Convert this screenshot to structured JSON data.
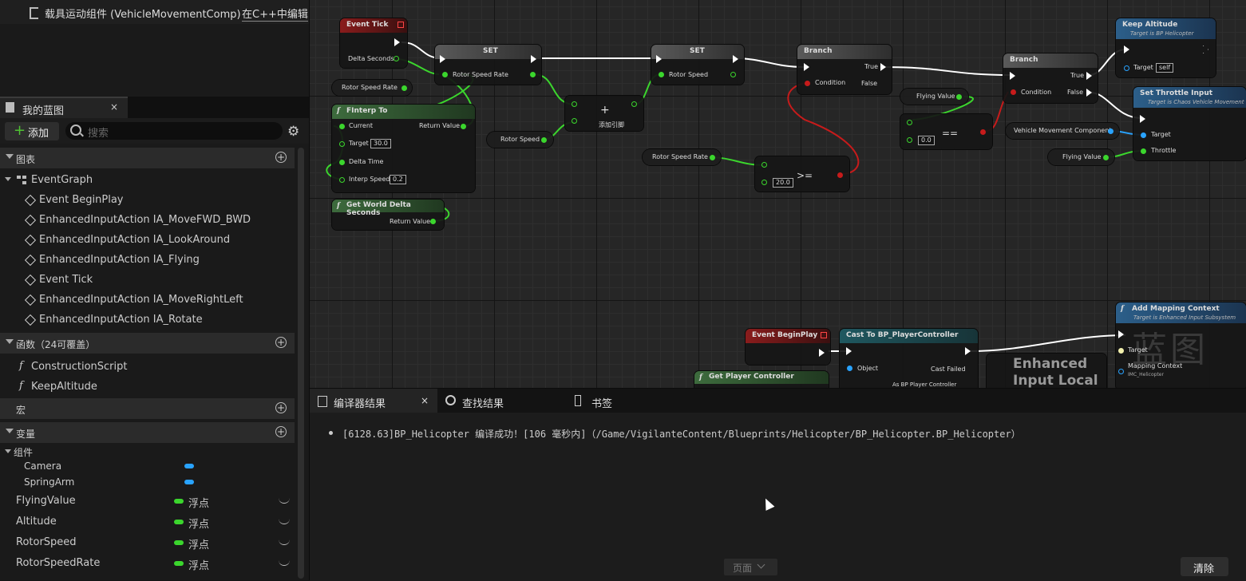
{
  "top_component": {
    "name": "载具运动组件 (VehicleMovementComp)",
    "edit_link": "在C++中编辑"
  },
  "my_blueprint": {
    "tab_label": "我的蓝图",
    "tab_close": "×",
    "add_label": "添加",
    "search_placeholder": "搜索"
  },
  "sections": {
    "graphs": {
      "label": "图表",
      "items": [
        "EventGraph"
      ],
      "events": [
        "Event BeginPlay",
        "EnhancedInputAction IA_MoveFWD_BWD",
        "EnhancedInputAction IA_LookAround",
        "EnhancedInputAction IA_Flying",
        "Event Tick",
        "EnhancedInputAction IA_MoveRightLeft",
        "EnhancedInputAction IA_Rotate"
      ]
    },
    "functions": {
      "label": "函数（24可覆盖）",
      "items": [
        "ConstructionScript",
        "KeepAltitude"
      ]
    },
    "macros": {
      "label": "宏"
    },
    "variables": {
      "label": "变量",
      "group_label": "组件",
      "components": [
        "Camera",
        "SpringArm"
      ],
      "vars": [
        {
          "name": "FlyingValue",
          "type": "浮点"
        },
        {
          "name": "Altitude",
          "type": "浮点"
        },
        {
          "name": "RotorSpeed",
          "type": "浮点"
        },
        {
          "name": "RotorSpeedRate",
          "type": "浮点"
        }
      ]
    }
  },
  "graph": {
    "event_tick": {
      "title": "Event Tick",
      "pin": "Delta Seconds"
    },
    "set1": {
      "title": "SET",
      "pin": "Rotor Speed Rate"
    },
    "set2": {
      "title": "SET",
      "pin": "Rotor Speed"
    },
    "branch1": {
      "title": "Branch",
      "true": "True",
      "false": "False",
      "condition": "Condition"
    },
    "branch2": {
      "title": "Branch",
      "true": "True",
      "false": "False",
      "condition": "Condition"
    },
    "keep_alt": {
      "title": "Keep Altitude",
      "sub": "Target is BP Helicopter",
      "target": "Target",
      "self": "self"
    },
    "set_throttle": {
      "title": "Set Throttle Input",
      "sub": "Target is Chaos Vehicle Movement",
      "target": "Target",
      "throttle": "Throttle"
    },
    "finterp": {
      "title": "FInterp To",
      "current": "Current",
      "target": "Target",
      "target_val": "30.0",
      "delta": "Delta Time",
      "interp": "Interp Speed",
      "interp_val": "0.2",
      "ret": "Return Value"
    },
    "getter_rsr": "Rotor Speed Rate",
    "getter_rs": "Rotor Speed",
    "getter_rsr2": "Rotor Speed Rate",
    "getter_fv": "Flying Value",
    "getter_fv2": "Flying Value",
    "getter_vmc": "Vehicle Movement Component",
    "add_node": {
      "plus": "+",
      "label": "添加引脚"
    },
    "ge_node": {
      "op": ">=",
      "val": "20.0"
    },
    "eq_node": {
      "op": "==",
      "val": "0.0"
    },
    "world_delta": {
      "title": "Get World Delta Seconds",
      "ret": "Return Value"
    },
    "begin_play": {
      "title": "Event BeginPlay"
    },
    "cast": {
      "title": "Cast To BP_PlayerController",
      "object": "Object",
      "failed": "Cast Failed",
      "as": "As BP Player Controller"
    },
    "get_pc": {
      "title": "Get Player Controller"
    },
    "enhanced": {
      "line1": "Enhanced",
      "line2": "Input Local"
    },
    "mapping": {
      "title": "Add Mapping Context",
      "sub": "Target is Enhanced Input Subsystem",
      "target": "Target",
      "ctx": "Mapping Context",
      "ctx_val": "IMC_Helicopter"
    },
    "watermark": "蓝图"
  },
  "bottom": {
    "tabs": [
      "编译器结果",
      "查找结果",
      "书签"
    ],
    "tab_close": "×",
    "message": "[6128.63]BP_Helicopter 编译成功！[106 毫秒内]（/Game/VigilanteContent/Blueprints/Helicopter/BP_Helicopter.BP_Helicopter）",
    "pager": "页面",
    "clear": "清除"
  }
}
